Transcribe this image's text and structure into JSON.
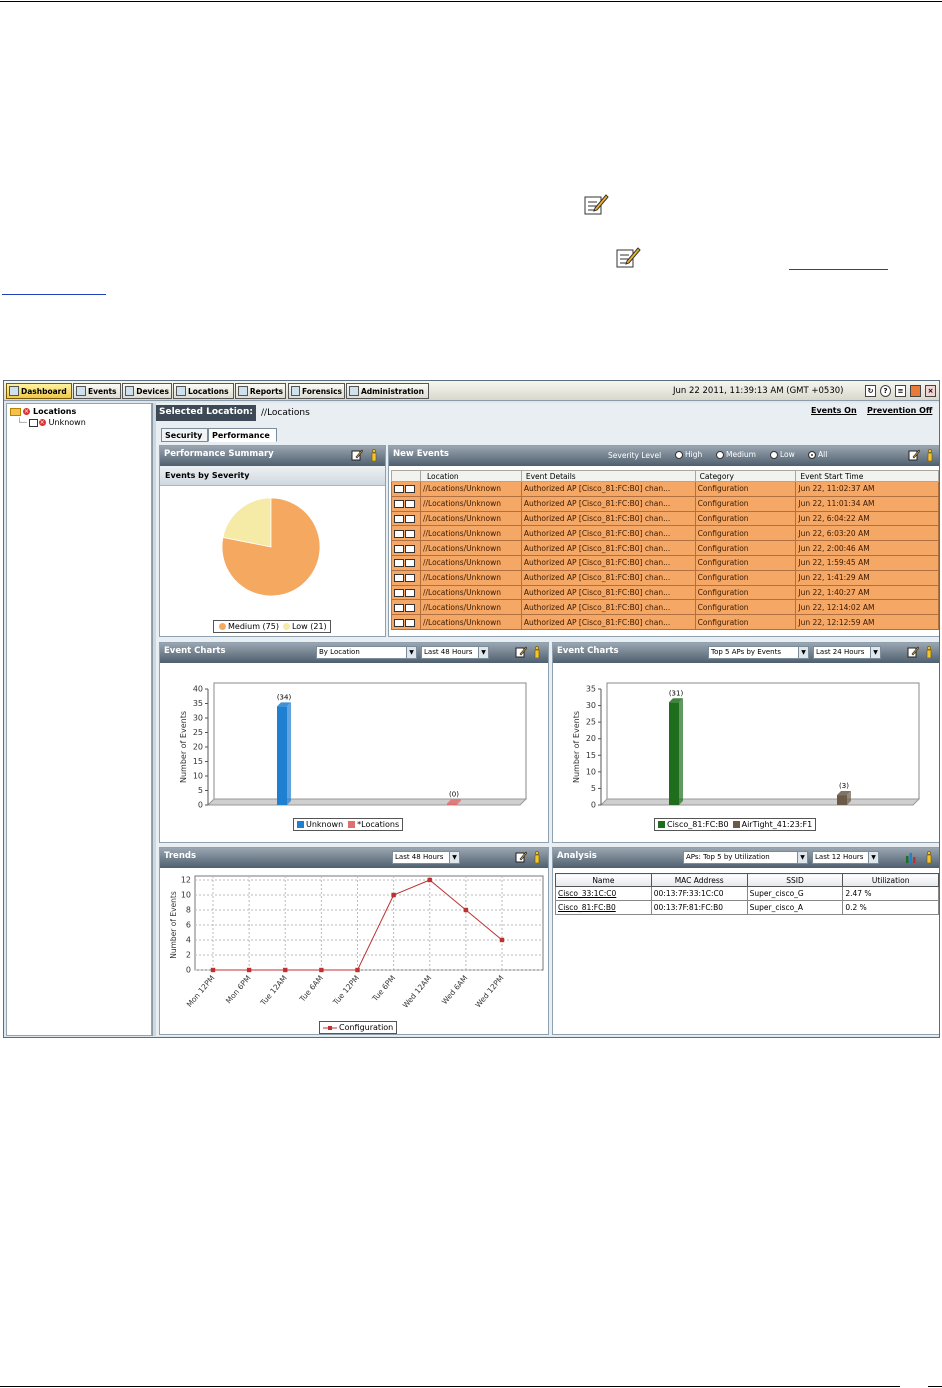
{
  "app": {
    "nav": [
      {
        "label": "Dashboard",
        "icon": "dashboard-icon"
      },
      {
        "label": "Events",
        "icon": "events-icon"
      },
      {
        "label": "Devices",
        "icon": "devices-icon"
      },
      {
        "label": "Locations",
        "icon": "locations-icon"
      },
      {
        "label": "Reports",
        "icon": "reports-icon"
      },
      {
        "label": "Forensics",
        "icon": "forensics-icon"
      },
      {
        "label": "Administration",
        "icon": "administration-icon"
      }
    ],
    "datetime": "Jun 22 2011, 11:39:13 AM (GMT +0530)",
    "tree": {
      "root": "Locations",
      "child": "Unknown"
    },
    "selected_location_label": "Selected Location:",
    "selected_location_path": "//Locations",
    "events_on": "Events On",
    "prevention_off": "Prevention Off",
    "tabs": [
      "Security",
      "Performance"
    ],
    "perf_summary": {
      "title": "Performance Summary",
      "subtitle": "Events by Severity",
      "legend_medium": "Medium (75)",
      "legend_low": "Low (21)",
      "colors": {
        "medium": "#f5a85f",
        "low": "#f5eaa6"
      }
    },
    "new_events": {
      "title": "New Events",
      "severity_label": "Severity Level",
      "severity_options": [
        "High",
        "Medium",
        "Low",
        "All"
      ],
      "columns": [
        "Location",
        "Event Details",
        "Category",
        "Event Start Time"
      ],
      "rows": [
        [
          "//Locations/Unknown",
          "Authorized AP [Cisco_81:FC:B0] chan...",
          "Configuration",
          "Jun 22, 11:02:37 AM"
        ],
        [
          "//Locations/Unknown",
          "Authorized AP [Cisco_81:FC:B0] chan...",
          "Configuration",
          "Jun 22, 11:01:34 AM"
        ],
        [
          "//Locations/Unknown",
          "Authorized AP [Cisco_81:FC:B0] chan...",
          "Configuration",
          "Jun 22, 6:04:22 AM"
        ],
        [
          "//Locations/Unknown",
          "Authorized AP [Cisco_81:FC:B0] chan...",
          "Configuration",
          "Jun 22, 6:03:20 AM"
        ],
        [
          "//Locations/Unknown",
          "Authorized AP [Cisco_81:FC:B0] chan...",
          "Configuration",
          "Jun 22, 2:00:46 AM"
        ],
        [
          "//Locations/Unknown",
          "Authorized AP [Cisco_81:FC:B0] chan...",
          "Configuration",
          "Jun 22, 1:59:45 AM"
        ],
        [
          "//Locations/Unknown",
          "Authorized AP [Cisco_81:FC:B0] chan...",
          "Configuration",
          "Jun 22, 1:41:29 AM"
        ],
        [
          "//Locations/Unknown",
          "Authorized AP [Cisco_81:FC:B0] chan...",
          "Configuration",
          "Jun 22, 1:40:27 AM"
        ],
        [
          "//Locations/Unknown",
          "Authorized AP [Cisco_81:FC:B0] chan...",
          "Configuration",
          "Jun 22, 12:14:02 AM"
        ],
        [
          "//Locations/Unknown",
          "Authorized AP [Cisco_81:FC:B0] chan...",
          "Configuration",
          "Jun 22, 12:12:59 AM"
        ]
      ]
    },
    "event_charts_left": {
      "title": "Event Charts",
      "select1": "By Location",
      "select2": "Last 48 Hours"
    },
    "event_charts_right": {
      "title": "Event Charts",
      "select1": "Top 5 APs by Events",
      "select2": "Last 24 Hours"
    },
    "trends": {
      "title": "Trends",
      "select1": "Last 48 Hours"
    },
    "analysis": {
      "title": "Analysis",
      "select1": "APs: Top 5 by Utilization",
      "select2": "Last 12 Hours",
      "columns": [
        "Name",
        "MAC Address",
        "SSID",
        "Utilization"
      ],
      "rows": [
        [
          "Cisco_33:1C:C0",
          "00:13:7F:33:1C:C0",
          "Super_cisco_G",
          "2.47 %"
        ],
        [
          "Cisco_81:FC:B0",
          "00:13:7F:81:FC:B0",
          "Super_cisco_A",
          "0.2 %"
        ]
      ]
    }
  },
  "chart_data": [
    {
      "type": "pie",
      "categories": [
        "Medium",
        "Low"
      ],
      "values": [
        75,
        21
      ],
      "title": "Events by Severity",
      "legend": "bottom"
    },
    {
      "type": "bar",
      "categories": [
        "Unknown",
        "*Locations"
      ],
      "values": [
        34,
        0
      ],
      "data_labels": [
        "(34)",
        "(0)"
      ],
      "ylabel": "Number of Events",
      "ylim": [
        0,
        40
      ],
      "yticks": [
        0,
        5,
        10,
        15,
        20,
        25,
        30,
        35,
        40
      ],
      "colors": [
        "#1f7fd0",
        "#e07070"
      ],
      "legend": "bottom"
    },
    {
      "type": "bar",
      "categories": [
        "Cisco_81:FC:B0",
        "AirTight_41:23:F1"
      ],
      "values": [
        31,
        3
      ],
      "data_labels": [
        "(31)",
        "(3)"
      ],
      "ylabel": "Number of Events",
      "ylim": [
        0,
        35
      ],
      "yticks": [
        0,
        5,
        10,
        15,
        20,
        25,
        30,
        35
      ],
      "colors": [
        "#1e6e1e",
        "#6b5a48"
      ],
      "legend": "bottom"
    },
    {
      "type": "line",
      "x": [
        "Mon 12PM",
        "Mon 6PM",
        "Tue 12AM",
        "Tue 6AM",
        "Tue 12PM",
        "Tue 6PM",
        "Wed 12AM",
        "Wed 6AM",
        "Wed 12PM"
      ],
      "series": [
        {
          "name": "Configuration",
          "values": [
            0,
            0,
            0,
            0,
            0,
            10,
            12,
            8,
            4
          ]
        }
      ],
      "ylabel": "Number of Events",
      "ylim": [
        0,
        12
      ],
      "yticks": [
        0,
        2,
        4,
        6,
        8,
        10,
        12
      ],
      "grid": true,
      "color": "#c03030",
      "legend": "bottom"
    }
  ]
}
